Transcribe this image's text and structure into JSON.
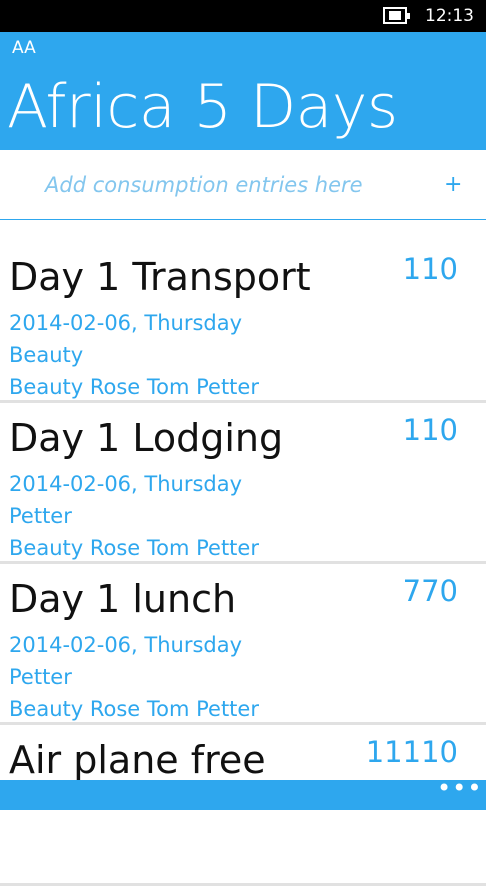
{
  "status_bar": {
    "time": "12:13",
    "battery_icon": "battery-charging-icon"
  },
  "header": {
    "app_label": "AA",
    "title": "Africa 5 Days"
  },
  "add_entry": {
    "placeholder": "Add consumption entries here",
    "plus_label": "+"
  },
  "entries": [
    {
      "title": "Day 1 Transport",
      "amount": "110",
      "date": "2014-02-06, Thursday",
      "payer": "Beauty",
      "members": "Beauty Rose Tom Petter"
    },
    {
      "title": "Day 1 Lodging",
      "amount": "110",
      "date": "2014-02-06, Thursday",
      "payer": "Petter",
      "members": "Beauty Rose Tom Petter"
    },
    {
      "title": "Day 1 lunch",
      "amount": "770",
      "date": "2014-02-06, Thursday",
      "payer": "Petter",
      "members": "Beauty Rose Tom Petter"
    },
    {
      "title": "Air plane free",
      "amount": "11110"
    }
  ],
  "app_bar": {
    "more_label": "•••"
  },
  "colors": {
    "accent": "#2ea7ee",
    "placeholder": "#83c6ee",
    "divider": "#e1e1e1",
    "status_bar": "#000000"
  }
}
